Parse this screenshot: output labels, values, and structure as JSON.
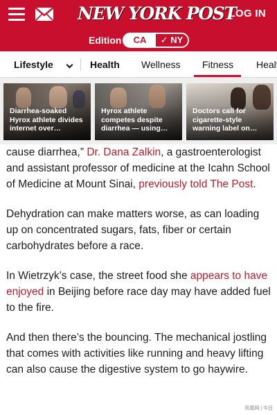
{
  "header": {
    "logo": "NEW YORK POST",
    "login_label": "LOG IN",
    "brand_color": "#c8102e",
    "icons": [
      "hamburger-menu-icon",
      "mail-icon"
    ]
  },
  "edition": {
    "label": "Edition",
    "options": [
      "CA",
      "✓ NY"
    ],
    "selected": "NY"
  },
  "nav": {
    "items": [
      "Lifestyle",
      "Health",
      "Wellness",
      "Fitness",
      "Healt"
    ],
    "active": "Fitness"
  },
  "cards": [
    {
      "title": "Diarrhea-soaked Hyrox athlete divides internet over…"
    },
    {
      "title": "Hyrox athlete competes despite diarrhea — using…"
    },
    {
      "title": "Doctors call for cigarette-style warning label on…"
    }
  ],
  "article": {
    "p1": {
      "t1": "cause diarrhea,” ",
      "link1": "Dr. Dana Zalkin",
      "t2": ", a gastroenterologist and assistant professor of medicine at the Icahn School of Medicine at Mount Sinai, ",
      "link2": "previously told The Post",
      "t3": "."
    },
    "p2": "Dehydration can make matters worse, as can loading up on concentrated sugars, fats, fiber or certain carbohydrates before a race.",
    "p3": {
      "t1": "In Wietrzyk’s case, the street food she ",
      "link1": "appears to have enjoyed",
      "t2": " in Beijing before race day may have added fuel to the fire."
    },
    "p4": "And then there’s the bouncing. The mechanical jostling that comes with activities like running and heavy lifting can also cause the digestive system to go haywire.",
    "link_color": "#b71c2e"
  },
  "watermark": "凤凰网 | 今日"
}
